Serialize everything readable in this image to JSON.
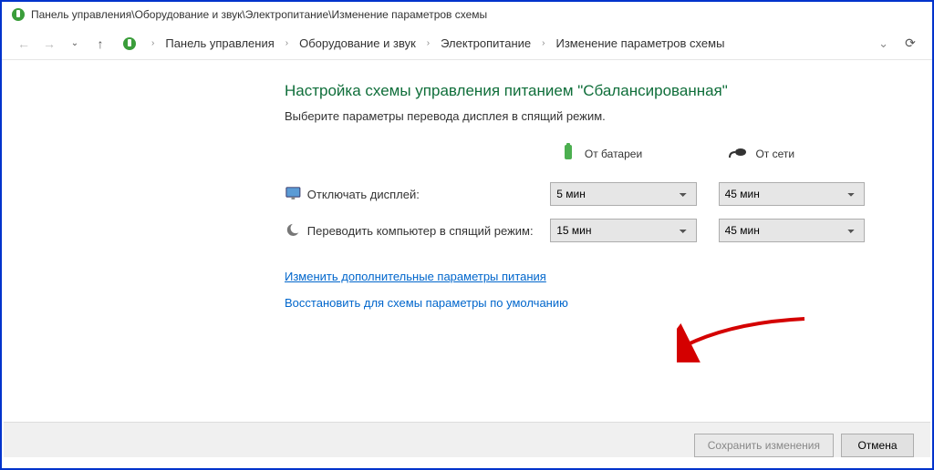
{
  "titlebar": {
    "path": "Панель управления\\Оборудование и звук\\Электропитание\\Изменение параметров схемы"
  },
  "breadcrumb": {
    "items": [
      "Панель управления",
      "Оборудование и звук",
      "Электропитание",
      "Изменение параметров схемы"
    ]
  },
  "page": {
    "heading": "Настройка схемы управления питанием \"Сбалансированная\"",
    "subtext": "Выберите параметры перевода дисплея в спящий режим."
  },
  "columns": {
    "battery": "От батареи",
    "plugged": "От сети"
  },
  "rows": {
    "display": {
      "label": "Отключать дисплей:",
      "battery_value": "5 мин",
      "plugged_value": "45 мин"
    },
    "sleep": {
      "label": "Переводить компьютер в спящий режим:",
      "battery_value": "15 мин",
      "plugged_value": "45 мин"
    }
  },
  "links": {
    "advanced": "Изменить дополнительные параметры питания",
    "restore": "Восстановить для схемы параметры по умолчанию"
  },
  "footer": {
    "save": "Сохранить изменения",
    "cancel": "Отмена"
  }
}
